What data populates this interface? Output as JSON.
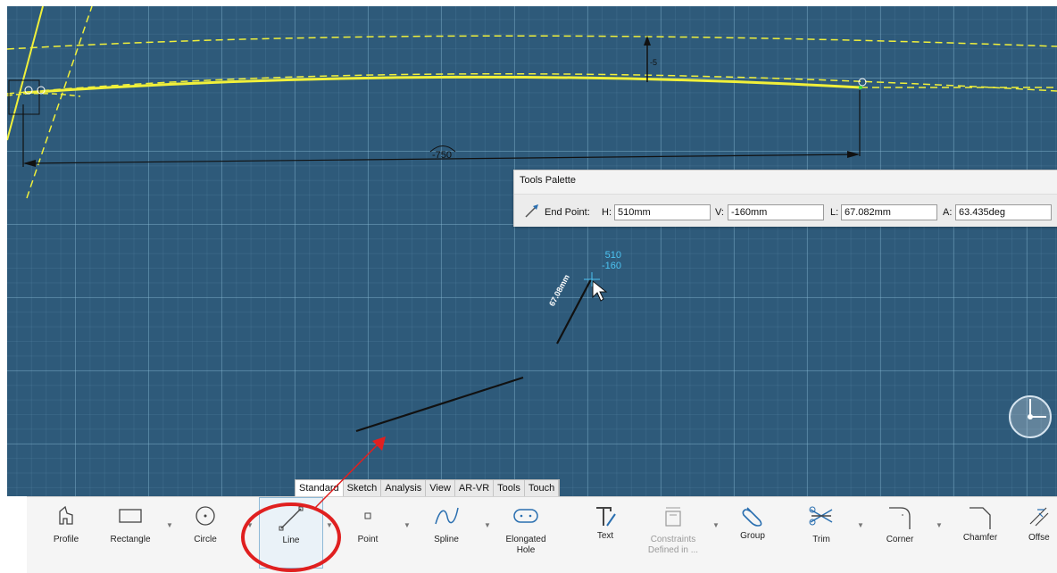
{
  "canvas": {
    "dimension_value": "-750",
    "small_dimension": "-5",
    "length_label": "67.08mm",
    "cursor_coords": {
      "h": "510",
      "v": "-160"
    }
  },
  "tools_palette": {
    "title": "Tools Palette",
    "end_point_label": "End Point:",
    "h_label": "H:",
    "h_value": "510mm",
    "v_label": "V:",
    "v_value": "-160mm",
    "l_label": "L:",
    "l_value": "67.082mm",
    "a_label": "A:",
    "a_value": "63.435deg"
  },
  "tabs": [
    "Standard",
    "Sketch",
    "Analysis",
    "View",
    "AR-VR",
    "Tools",
    "Touch"
  ],
  "tools": {
    "profile": "Profile",
    "rectangle": "Rectangle",
    "circle": "Circle",
    "line": "Line",
    "point": "Point",
    "spline": "Spline",
    "elongated_hole_1": "Elongated",
    "elongated_hole_2": "Hole",
    "text": "Text",
    "constraints_1": "Constraints",
    "constraints_2": "Defined in ...",
    "group": "Group",
    "trim": "Trim",
    "corner": "Corner",
    "chamfer": "Chamfer",
    "offset": "Offse"
  },
  "colors": {
    "canvas_bg": "#2e5a7a",
    "curve": "#f0f03a",
    "annotation": "#e02020",
    "coord_text": "#4cc3f2"
  },
  "icons": [
    "profile-icon",
    "rectangle-icon",
    "circle-icon",
    "line-icon",
    "point-icon",
    "spline-icon",
    "elongated-hole-icon",
    "text-icon",
    "constraints-icon",
    "group-icon",
    "trim-icon",
    "corner-icon",
    "chamfer-icon",
    "offset-icon",
    "compass-icon",
    "cursor-icon"
  ]
}
